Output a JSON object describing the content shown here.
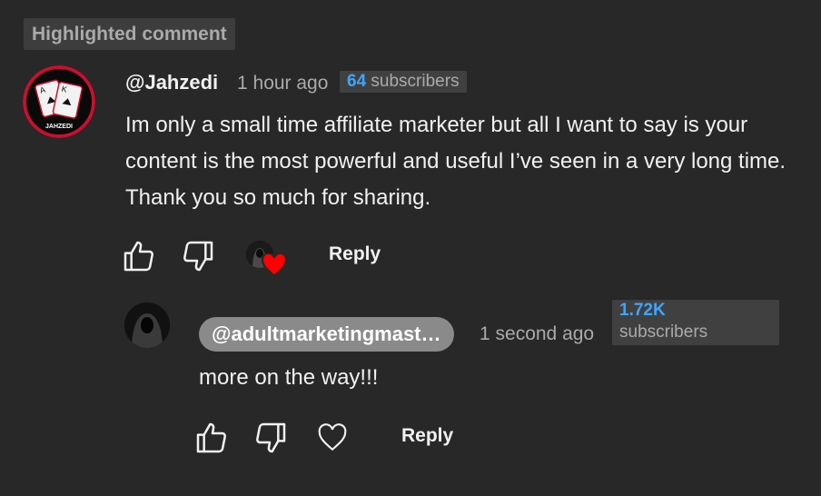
{
  "highlight_label": "Highlighted comment",
  "comment": {
    "author": "@Jahzedi",
    "time": "1 hour ago",
    "subscriber_badge": {
      "count": "64",
      "label": "subscribers"
    },
    "avatar_label": "JAHZEDI",
    "text": "Im only a small time affiliate marketer but all I want to say is your content is the most powerful and useful I’ve seen in a very long time. Thank you so much for sharing.",
    "reply_label": "Reply",
    "icons": [
      "thumb-up-icon",
      "thumb-down-icon",
      "creator-heart-icon"
    ]
  },
  "reply": {
    "author": "@adultmarketingmast…",
    "time": "1 second ago",
    "subscriber_badge": {
      "count": "1.72K",
      "label": "subscribers"
    },
    "text": "more on the way!!!",
    "reply_label": "Reply",
    "icons": [
      "thumb-up-icon",
      "thumb-down-icon",
      "heart-outline-icon"
    ]
  },
  "colors": {
    "background": "#282828",
    "accent": "#3ea6ff",
    "heart": "#ff0000",
    "muted_text": "#aaaaaa"
  }
}
